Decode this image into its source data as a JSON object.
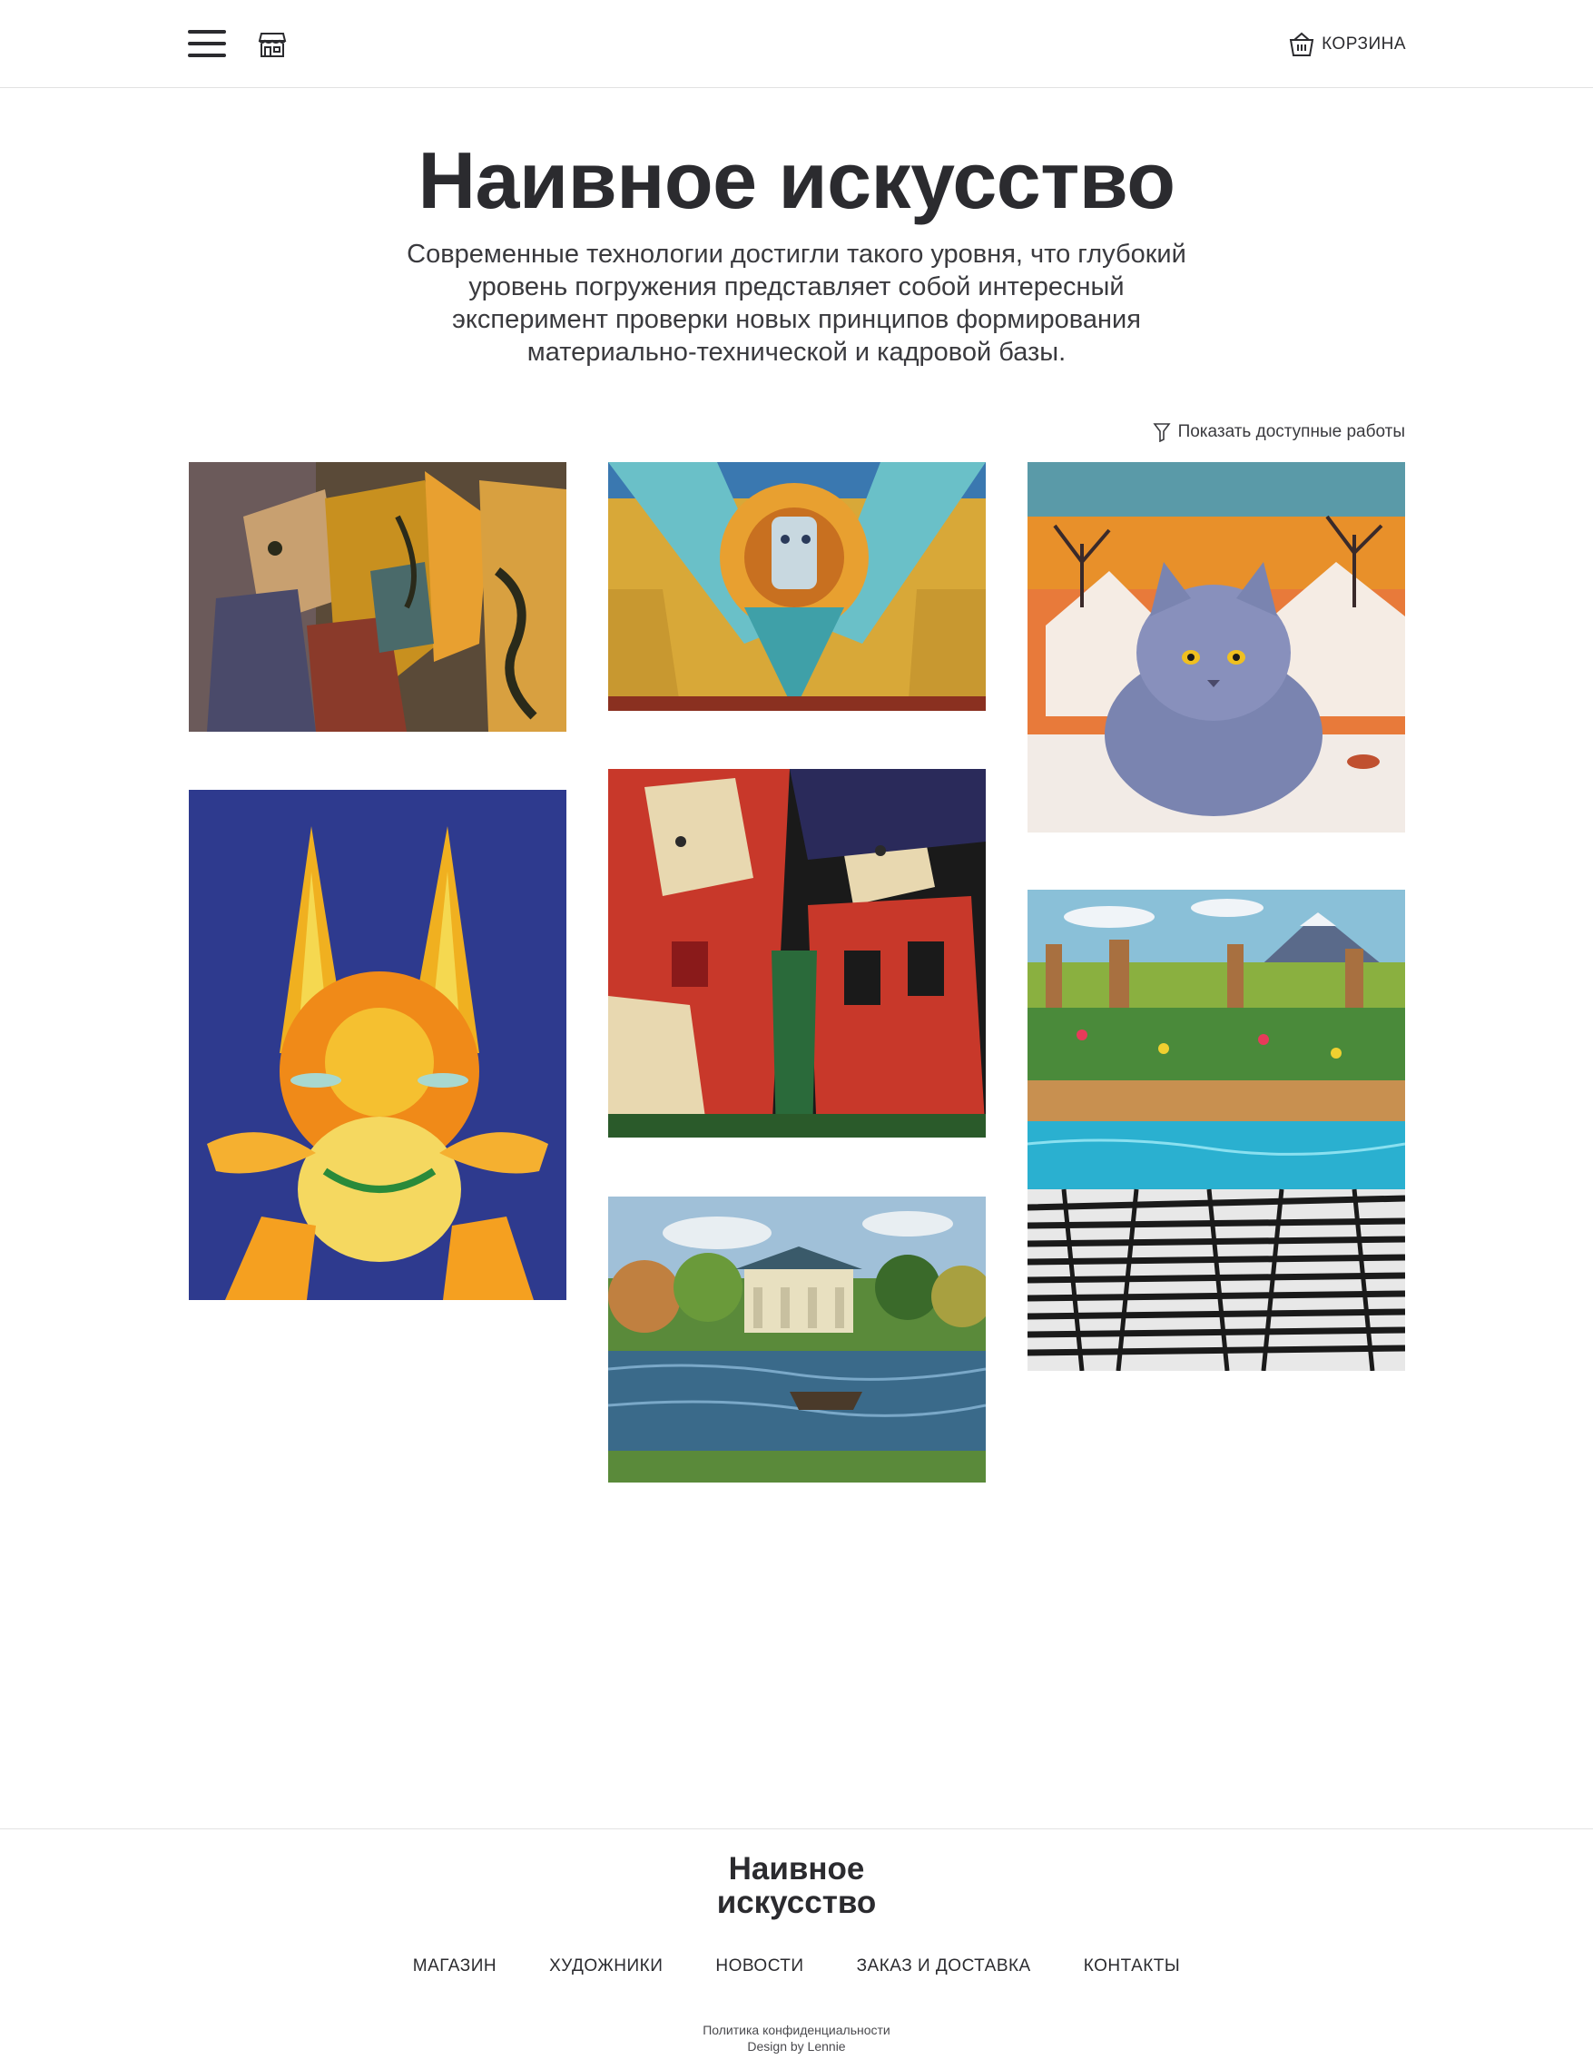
{
  "header": {
    "menu_icon": "hamburger-icon",
    "shop_icon": "storefront-icon",
    "cart_icon": "basket-icon",
    "cart_label": "КОРЗИНА"
  },
  "hero": {
    "title": "Наивное искусство",
    "description": "Современные технологии достигли такого уровня, что глубокий уровень погружения представляет собой интересный эксперимент проверки новых принципов формирования материально-технической и кадровой базы."
  },
  "filter": {
    "icon": "filter-icon",
    "label": "Показать доступные работы"
  },
  "gallery": {
    "artworks": [
      {
        "id": "artwork-abstract-figures",
        "palette": [
          "#6b5a3a",
          "#c8901f",
          "#4a6a6a",
          "#8a3a2a",
          "#d9b070"
        ]
      },
      {
        "id": "artwork-sun-face",
        "palette": [
          "#d9a02a",
          "#3fa8b8",
          "#e8c060",
          "#8a4a20",
          "#c0d8e0"
        ]
      },
      {
        "id": "artwork-blue-cat",
        "palette": [
          "#e87a3a",
          "#7a84b0",
          "#f5e8e0",
          "#2a2a2a",
          "#c05030"
        ]
      },
      {
        "id": "artwork-orange-creature",
        "palette": [
          "#2a3a8a",
          "#f0a020",
          "#e86018",
          "#f5d050",
          "#3a4aa0"
        ]
      },
      {
        "id": "artwork-two-figures",
        "palette": [
          "#c8382a",
          "#1a1a1a",
          "#e8d8b0",
          "#2a6a3a",
          "#8a5a3a"
        ]
      },
      {
        "id": "artwork-zebra-savanna",
        "palette": [
          "#2ab0d0",
          "#4a8a3a",
          "#e8a030",
          "#1a1a1a",
          "#f0f0f0"
        ]
      },
      {
        "id": "artwork-palace-lake",
        "palette": [
          "#3a6a8a",
          "#5a8a3a",
          "#e8e0c0",
          "#a0c0d8",
          "#c08040"
        ]
      }
    ]
  },
  "footer": {
    "logo": "Наивное искусство",
    "nav": [
      {
        "label": "МАГАЗИН"
      },
      {
        "label": "ХУДОЖНИКИ"
      },
      {
        "label": "НОВОСТИ"
      },
      {
        "label": "ЗАКАЗ И ДОСТАВКА"
      },
      {
        "label": "КОНТАКТЫ"
      }
    ],
    "policy": "Политика конфиденциальности",
    "credit": "Design by Lennie"
  }
}
